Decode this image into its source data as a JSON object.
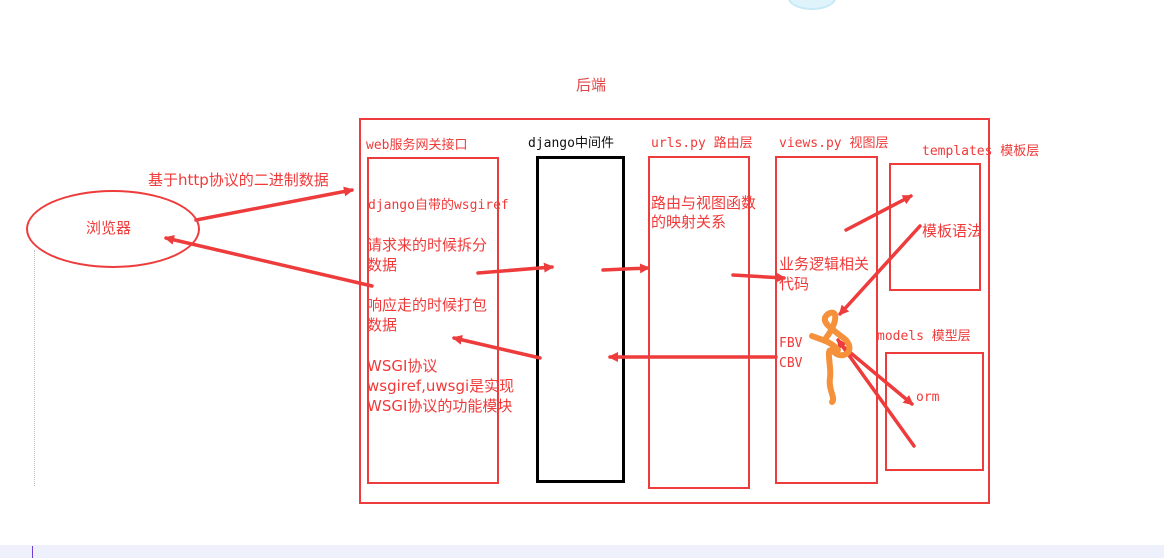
{
  "title": "后端",
  "browser": {
    "label": "浏览器"
  },
  "request_label": "基于http协议的二进制数据",
  "wsgi": {
    "header": "web服务网关接口",
    "line1": "django自带的wsgiref",
    "line2a": "请求来的时候拆分",
    "line2b": "数据",
    "line3a": "响应走的时候打包",
    "line3b": "数据",
    "line4a": "WSGI协议",
    "line4b": "wsgiref,uwsgi是实现",
    "line4c": "WSGI协议的功能模块"
  },
  "middleware": {
    "header": "django中间件"
  },
  "urls": {
    "header": "urls.py 路由层",
    "line1": "路由与视图函数",
    "line2": "的映射关系"
  },
  "views": {
    "header": "views.py  视图层",
    "line1": "业务逻辑相关",
    "line2": "代码",
    "fbv": "FBV",
    "cbv": "CBV"
  },
  "templates": {
    "header": "templates 模板层",
    "body": "模板语法"
  },
  "models": {
    "header": "models 模型层",
    "body": "orm"
  },
  "colors": {
    "accent": "#ee3b3b",
    "middleware_border": "#000000",
    "scribble": "#f5913a"
  }
}
